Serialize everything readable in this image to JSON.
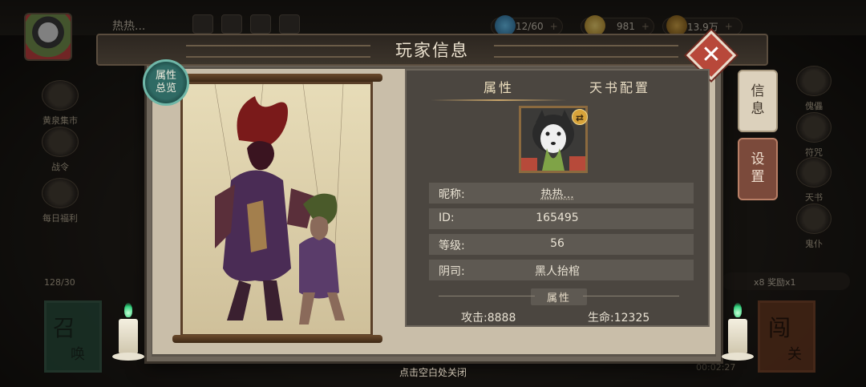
{
  "hud": {
    "player_name": "热热...",
    "soul_count": "12/60",
    "gold": "981",
    "coins": "13.9万",
    "energy": "128/30",
    "keys_text": "x8 奖励x1",
    "timer": "00:02:27",
    "left_menu": [
      "黄泉集市",
      "战令",
      "每日福利"
    ],
    "right_menu": [
      "傀儡",
      "符咒",
      "天书",
      "鬼仆"
    ],
    "summon_main": "召",
    "summon_sub": "唤",
    "battle_main": "闯",
    "battle_sub": "关"
  },
  "modal": {
    "title": "玩家信息",
    "close_icon": "close-icon",
    "badge": "属性\n总览",
    "tabs": [
      {
        "label": "属性",
        "active": true
      },
      {
        "label": "天书配置",
        "active": false
      }
    ],
    "profile": {
      "nickname_label": "昵称:",
      "nickname": "热热...",
      "id_label": "ID:",
      "id": "165495",
      "level_label": "等级:",
      "level": "56",
      "camp_label": "阴司:",
      "camp": "黑人抬棺"
    },
    "attributes": {
      "heading": "属性",
      "attack": "攻击:8888",
      "health": "生命:12325"
    },
    "side_tabs": [
      {
        "label": "信\n息",
        "active": true
      },
      {
        "label": "设\n置",
        "active": false
      }
    ],
    "close_hint": "点击空白处关闭"
  },
  "colors": {
    "close_button": "#b8483a",
    "badge": "#2f6a64",
    "panel": "#4b4640",
    "accent": "#c9a56a"
  }
}
